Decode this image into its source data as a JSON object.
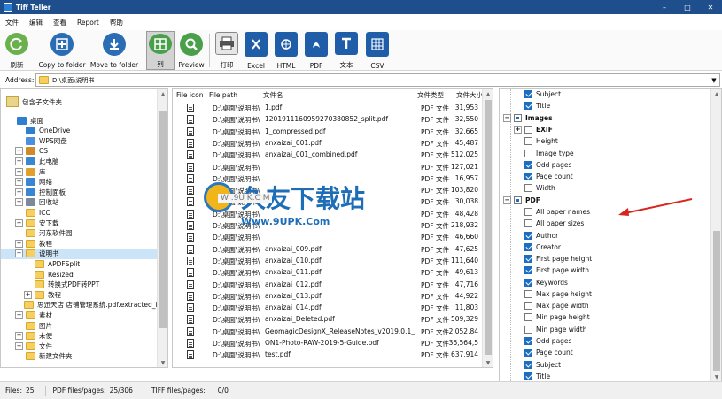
{
  "window": {
    "title": "Tiff Teller",
    "controls": [
      "–",
      "□",
      "✕"
    ]
  },
  "menu": [
    "文件",
    "编辑",
    "查看",
    "Report",
    "帮助"
  ],
  "toolbar": {
    "buttons": [
      {
        "id": "refresh",
        "label": "刷新",
        "icon": "refresh-icon",
        "color": "#6ab04c"
      },
      {
        "id": "copy",
        "label": "Copy to folder",
        "icon": "copy-to-folder-icon",
        "color": "#2a6db5"
      },
      {
        "id": "move",
        "label": "Move to folder",
        "icon": "move-to-folder-icon",
        "color": "#2a6db5"
      },
      {
        "id": "columns",
        "label": "列",
        "icon": "columns-icon",
        "color": "#4aa04a"
      },
      {
        "id": "preview",
        "label": "Preview",
        "icon": "preview-icon",
        "color": "#4aa04a"
      },
      {
        "id": "print",
        "label": "打印",
        "icon": "printer-icon",
        "color": "#555555"
      },
      {
        "id": "excel",
        "label": "Excel",
        "icon": "excel-icon",
        "color": "#1f5da8"
      },
      {
        "id": "html",
        "label": "HTML",
        "icon": "html-icon",
        "color": "#1f5da8"
      },
      {
        "id": "pdf",
        "label": "PDF",
        "icon": "pdf-icon",
        "color": "#1f5da8"
      },
      {
        "id": "text",
        "label": "文本",
        "icon": "text-icon",
        "color": "#1f5da8"
      },
      {
        "id": "csv",
        "label": "CSV",
        "icon": "csv-icon",
        "color": "#1f5da8"
      }
    ]
  },
  "address": {
    "label": "Address:",
    "value": "D:\\桌面\\说明书"
  },
  "tree": {
    "header": "包含子文件夹",
    "items": [
      {
        "label": "桌面",
        "level": 0,
        "expander": "",
        "icon": "desktop-icon",
        "color": "#2f7fd0"
      },
      {
        "label": "OneDrive",
        "level": 1,
        "expander": "",
        "icon": "cloud-icon",
        "color": "#2f7fd0"
      },
      {
        "label": "WPS网盘",
        "level": 1,
        "expander": "",
        "icon": "cloud-icon",
        "color": "#4a8fe0"
      },
      {
        "label": "CS",
        "level": 1,
        "expander": "+",
        "icon": "user-icon",
        "color": "#d08a2a"
      },
      {
        "label": "此电脑",
        "level": 1,
        "expander": "+",
        "icon": "computer-icon",
        "color": "#3a86d0"
      },
      {
        "label": "库",
        "level": 1,
        "expander": "+",
        "icon": "library-icon",
        "color": "#e0a030"
      },
      {
        "label": "网络",
        "level": 1,
        "expander": "+",
        "icon": "network-icon",
        "color": "#3a86d0"
      },
      {
        "label": "控制面板",
        "level": 1,
        "expander": "+",
        "icon": "control-panel-icon",
        "color": "#3a86d0"
      },
      {
        "label": "回收站",
        "level": 1,
        "expander": "+",
        "icon": "recycle-bin-icon",
        "color": "#7a8a9a"
      },
      {
        "label": "ICO",
        "level": 1,
        "expander": "",
        "icon": "folder-icon",
        "color": "#f6cf5e"
      },
      {
        "label": "安下载",
        "level": 1,
        "expander": "+",
        "icon": "folder-icon",
        "color": "#f6cf5e"
      },
      {
        "label": "河东软件园",
        "level": 1,
        "expander": "",
        "icon": "folder-icon",
        "color": "#f6cf5e"
      },
      {
        "label": "教程",
        "level": 1,
        "expander": "+",
        "icon": "folder-icon",
        "color": "#f6cf5e"
      },
      {
        "label": "说明书",
        "level": 1,
        "expander": "−",
        "icon": "folder-icon",
        "color": "#f6cf5e",
        "selected": true
      },
      {
        "label": "APDFSplit",
        "level": 2,
        "expander": "",
        "icon": "folder-icon",
        "color": "#f6cf5e"
      },
      {
        "label": "Resized",
        "level": 2,
        "expander": "",
        "icon": "folder-icon",
        "color": "#f6cf5e"
      },
      {
        "label": "转换式PDF转PPT",
        "level": 2,
        "expander": "",
        "icon": "folder-icon",
        "color": "#f6cf5e"
      },
      {
        "label": "教程",
        "level": 2,
        "expander": "+",
        "icon": "folder-icon",
        "color": "#f6cf5e"
      },
      {
        "label": "思迅天店 店铺管理系统.pdf.extracted_im",
        "level": 2,
        "expander": "",
        "icon": "folder-icon",
        "color": "#f6cf5e"
      },
      {
        "label": "素材",
        "level": 1,
        "expander": "+",
        "icon": "folder-icon",
        "color": "#f6cf5e"
      },
      {
        "label": "图片",
        "level": 1,
        "expander": "",
        "icon": "folder-icon",
        "color": "#f6cf5e"
      },
      {
        "label": "未使",
        "level": 1,
        "expander": "+",
        "icon": "folder-icon",
        "color": "#f6cf5e"
      },
      {
        "label": "文件",
        "level": 1,
        "expander": "+",
        "icon": "folder-icon",
        "color": "#f6cf5e"
      },
      {
        "label": "新建文件夹",
        "level": 1,
        "expander": "",
        "icon": "folder-icon",
        "color": "#f6cf5e"
      }
    ]
  },
  "files": {
    "columns": [
      "File icon",
      "File path",
      "文件名",
      "文件类型",
      "文件大小"
    ],
    "rows": [
      {
        "path": "D:\\桌面\\说明书\\",
        "name": "1.pdf",
        "type": "PDF 文件",
        "size": "31,953"
      },
      {
        "path": "D:\\桌面\\说明书\\",
        "name": "1201911160959270380852_split.pdf",
        "type": "PDF 文件",
        "size": "32,550"
      },
      {
        "path": "D:\\桌面\\说明书\\",
        "name": "1_compressed.pdf",
        "type": "PDF 文件",
        "size": "32,665"
      },
      {
        "path": "D:\\桌面\\说明书\\",
        "name": "anxaizai_001.pdf",
        "type": "PDF 文件",
        "size": "45,487"
      },
      {
        "path": "D:\\桌面\\说明书\\",
        "name": "anxaizai_001_combined.pdf",
        "type": "PDF 文件",
        "size": "512,025"
      },
      {
        "path": "D:\\桌面\\说明书\\",
        "name": "",
        "type": "PDF 文件",
        "size": "127,021"
      },
      {
        "path": "D:\\桌面\\说明书\\",
        "name": "",
        "type": "PDF 文件",
        "size": "16,957"
      },
      {
        "path": "D:\\桌面\\说明书\\",
        "name": "",
        "type": "PDF 文件",
        "size": "103,820"
      },
      {
        "path": "D:\\桌面\\说明书\\",
        "name": "",
        "type": "PDF 文件",
        "size": "30,038"
      },
      {
        "path": "D:\\桌面\\说明书\\",
        "name": "",
        "type": "PDF 文件",
        "size": "48,428"
      },
      {
        "path": "D:\\桌面\\说明书\\",
        "name": "",
        "type": "PDF 文件",
        "size": "218,932"
      },
      {
        "path": "D:\\桌面\\说明书\\",
        "name": "",
        "type": "PDF 文件",
        "size": "46,660"
      },
      {
        "path": "D:\\桌面\\说明书\\",
        "name": "anxaizai_009.pdf",
        "type": "PDF 文件",
        "size": "47,625"
      },
      {
        "path": "D:\\桌面\\说明书\\",
        "name": "anxaizai_010.pdf",
        "type": "PDF 文件",
        "size": "111,640"
      },
      {
        "path": "D:\\桌面\\说明书\\",
        "name": "anxaizai_011.pdf",
        "type": "PDF 文件",
        "size": "49,613"
      },
      {
        "path": "D:\\桌面\\说明书\\",
        "name": "anxaizai_012.pdf",
        "type": "PDF 文件",
        "size": "47,716"
      },
      {
        "path": "D:\\桌面\\说明书\\",
        "name": "anxaizai_013.pdf",
        "type": "PDF 文件",
        "size": "44,922"
      },
      {
        "path": "D:\\桌面\\说明书\\",
        "name": "anxaizai_014.pdf",
        "type": "PDF 文件",
        "size": "11,803"
      },
      {
        "path": "D:\\桌面\\说明书\\",
        "name": "anxaizai_Deleted.pdf",
        "type": "PDF 文件",
        "size": "509,329"
      },
      {
        "path": "D:\\桌面\\说明书\\",
        "name": "GeomagicDesignX_ReleaseNotes_v2019.0.1_en-EN.pdf",
        "type": "PDF 文件",
        "size": "2,052,84"
      },
      {
        "path": "D:\\桌面\\说明书\\",
        "name": "ON1-Photo-RAW-2019-5-Guide.pdf",
        "type": "PDF 文件",
        "size": "36,564,5"
      },
      {
        "path": "D:\\桌面\\说明书\\",
        "name": "test.pdf",
        "type": "PDF 文件",
        "size": "637,914"
      }
    ]
  },
  "watermark": {
    "text": "久友下载站",
    "url": "Www.9UPK.Com",
    "ghost": "W .9U K.C M"
  },
  "properties": {
    "items": [
      {
        "label": "Subject",
        "checked": true,
        "group": false,
        "level": 1
      },
      {
        "label": "Title",
        "checked": true,
        "group": false,
        "level": 1
      },
      {
        "label": "Images",
        "checked": "partial",
        "group": true,
        "expander": "−",
        "level": 0
      },
      {
        "label": "EXIF",
        "checked": false,
        "group": true,
        "expander": "+",
        "level": 1
      },
      {
        "label": "Height",
        "checked": false,
        "group": false,
        "level": 1
      },
      {
        "label": "Image type",
        "checked": false,
        "group": false,
        "level": 1
      },
      {
        "label": "Odd pages",
        "checked": true,
        "group": false,
        "level": 1
      },
      {
        "label": "Page count",
        "checked": true,
        "group": false,
        "level": 1
      },
      {
        "label": "Width",
        "checked": false,
        "group": false,
        "level": 1
      },
      {
        "label": "PDF",
        "checked": "partial",
        "group": true,
        "expander": "−",
        "level": 0
      },
      {
        "label": "All paper names",
        "checked": false,
        "group": false,
        "level": 1
      },
      {
        "label": "All paper sizes",
        "checked": false,
        "group": false,
        "level": 1
      },
      {
        "label": "Author",
        "checked": true,
        "group": false,
        "level": 1
      },
      {
        "label": "Creator",
        "checked": true,
        "group": false,
        "level": 1
      },
      {
        "label": "First page height",
        "checked": true,
        "group": false,
        "level": 1
      },
      {
        "label": "First page width",
        "checked": true,
        "group": false,
        "level": 1
      },
      {
        "label": "Keywords",
        "checked": true,
        "group": false,
        "level": 1
      },
      {
        "label": "Max page height",
        "checked": false,
        "group": false,
        "level": 1
      },
      {
        "label": "Max page width",
        "checked": false,
        "group": false,
        "level": 1
      },
      {
        "label": "Min page height",
        "checked": false,
        "group": false,
        "level": 1
      },
      {
        "label": "Min page width",
        "checked": false,
        "group": false,
        "level": 1
      },
      {
        "label": "Odd pages",
        "checked": true,
        "group": false,
        "level": 1
      },
      {
        "label": "Page count",
        "checked": true,
        "group": false,
        "level": 1
      },
      {
        "label": "Subject",
        "checked": true,
        "group": false,
        "level": 1
      },
      {
        "label": "Title",
        "checked": true,
        "group": false,
        "level": 1
      }
    ]
  },
  "status": {
    "files_label": "Files:",
    "files": "25",
    "pdf_label": "PDF files/pages:",
    "pdf": "25/306",
    "tiff_label": "TIFF files/pages:",
    "tiff": "0/0"
  }
}
